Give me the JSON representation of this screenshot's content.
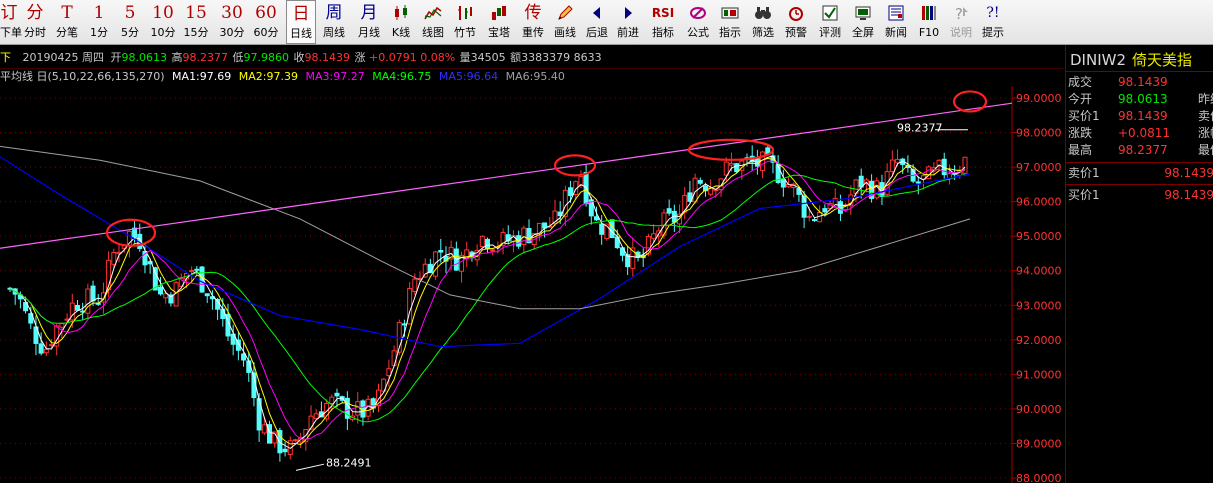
{
  "toolbar": {
    "buttons": [
      {
        "big": "订",
        "label": "下单"
      },
      {
        "big": "分",
        "label": "分时"
      },
      {
        "big": "T",
        "label": "分笔"
      },
      {
        "big": "1",
        "label": "1分"
      },
      {
        "big": "5",
        "label": "5分"
      },
      {
        "big": "10",
        "label": "10分"
      },
      {
        "big": "15",
        "label": "15分"
      },
      {
        "big": "30",
        "label": "30分"
      },
      {
        "big": "60",
        "label": "60分"
      },
      {
        "big": "日",
        "label": "日线"
      },
      {
        "big": "周",
        "label": "周线"
      },
      {
        "big": "月",
        "label": "月线"
      },
      {
        "icon": "candlestick-icon",
        "label": "K线"
      },
      {
        "icon": "line-chart-icon",
        "label": "线图"
      },
      {
        "icon": "bamboo-line-icon",
        "label": "竹节"
      },
      {
        "icon": "tower-icon",
        "label": "宝塔"
      },
      {
        "big": "传",
        "label": "重传"
      },
      {
        "icon": "pencil-icon",
        "label": "画线"
      },
      {
        "icon": "arrow-left-icon",
        "label": "后退"
      },
      {
        "icon": "arrow-right-icon",
        "label": "前进"
      },
      {
        "big": "RSI",
        "label": "指标"
      },
      {
        "icon": "formula-icon",
        "label": "公式"
      },
      {
        "icon": "indicator-icon",
        "label": "指示"
      },
      {
        "icon": "binoculars-icon",
        "label": "筛选"
      },
      {
        "icon": "alarm-icon",
        "label": "预警"
      },
      {
        "icon": "evaluate-icon",
        "label": "评测"
      },
      {
        "icon": "fullscreen-icon",
        "label": "全屏"
      },
      {
        "icon": "news-icon",
        "label": "新闻"
      },
      {
        "icon": "f10-icon",
        "label": "F10"
      },
      {
        "icon": "help-icon",
        "label": "说明"
      },
      {
        "big": "?!",
        "label": "提示"
      }
    ]
  },
  "info": {
    "prefix": "下",
    "date": "20190425",
    "weekday": "周四",
    "open_label": "开",
    "open": "98.0613",
    "high_label": "高",
    "high": "98.2377",
    "low_label": "低",
    "low": "97.9860",
    "close_label": "收",
    "close": "98.1439",
    "chg_label": "涨",
    "chg": "+0.0791",
    "pct": "0.08%",
    "vol_label": "量",
    "vol": "34505",
    "amt_label": "额",
    "amt": "3383379",
    "extra": "8633"
  },
  "ma_line": {
    "title": "平均线 日(5,10,22,66,135,270)",
    "ma1": "MA1:97.69",
    "ma2": "MA2:97.39",
    "ma3": "MA3:97.27",
    "ma4": "MA4:96.75",
    "ma5": "MA5:96.64",
    "ma6": "MA6:95.40"
  },
  "chart_data": {
    "type": "candlestick",
    "y_ticks": [
      "99.0000",
      "98.0000",
      "97.0000",
      "96.0000",
      "95.0000",
      "94.0000",
      "93.0000",
      "92.0000",
      "91.0000",
      "90.0000",
      "89.0000",
      "88.0000"
    ],
    "ylim": [
      88.0,
      99.0
    ],
    "annotations": [
      "98.2377",
      "88.2491"
    ],
    "colors": {
      "up": "#ff3232",
      "down": "#54fcfc",
      "ma1": "#ffffff",
      "ma2": "#ffff00",
      "ma3": "#ff00ff",
      "ma4": "#00ff00",
      "ma5": "#0000ff",
      "ma6": "#a0a0a0",
      "trend": "#ff66ff",
      "circle": "#ff2020"
    }
  },
  "panel": {
    "code": "DINIW2",
    "name": "倚天美指",
    "rows": [
      {
        "label": "成交",
        "value": "98.1439",
        "extra": ""
      },
      {
        "label": "今开",
        "value": "98.0613",
        "extra": "昨结"
      },
      {
        "label": "买价1",
        "value": "98.1439",
        "extra": "卖价"
      },
      {
        "label": "涨跌",
        "value": "+0.0811",
        "extra": "涨幅"
      },
      {
        "label": "最高",
        "value": "98.2377",
        "extra": "最低"
      }
    ],
    "sell1_label": "卖价1",
    "sell1": "98.1439",
    "buy1_label": "买价1",
    "buy1": "98.1439"
  }
}
